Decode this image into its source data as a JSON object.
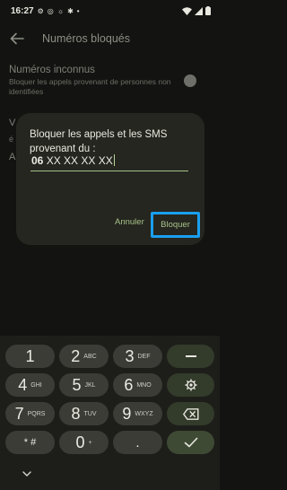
{
  "status_bar": {
    "time": "16:27"
  },
  "app_bar": {
    "title": "Numéros bloqués"
  },
  "settings": {
    "unknown_title": "Numéros inconnus",
    "unknown_summary": "Bloquer les appels provenant de personnes non identifiées",
    "obscured_1": "V",
    "obscured_2": "é",
    "obscured_3": "A"
  },
  "dialog": {
    "title": "Bloquer les appels et les SMS provenant du :",
    "input_value_bold": "06",
    "input_value_rest": " XX XX XX XX",
    "cancel_label": "Annuler",
    "confirm_label": "Bloquer"
  },
  "keyboard": {
    "keys": [
      {
        "main": "1",
        "sub": ""
      },
      {
        "main": "2",
        "sub": "ABC"
      },
      {
        "main": "3",
        "sub": "DEF"
      },
      {
        "main": "4",
        "sub": "GHI"
      },
      {
        "main": "5",
        "sub": "JKL"
      },
      {
        "main": "6",
        "sub": "MNO"
      },
      {
        "main": "7",
        "sub": "PQRS"
      },
      {
        "main": "8",
        "sub": "TUV"
      },
      {
        "main": "9",
        "sub": "WXYZ"
      },
      {
        "main": "* #",
        "sub": ""
      },
      {
        "main": "0",
        "sub": "+"
      },
      {
        "main": ".",
        "sub": ""
      }
    ]
  },
  "colors": {
    "accent": "#a6c28a",
    "focus_outline": "#1a9ff0",
    "dialog_bg": "#25261f"
  },
  "icons": [
    "settings-icon",
    "compass-icon",
    "brightness-icon",
    "bluetooth-icon",
    "dot-icon",
    "wifi-icon",
    "signal-icon",
    "battery-icon",
    "back-arrow-icon",
    "minus-icon",
    "settings-key-icon",
    "backspace-icon",
    "checkmark-icon",
    "chevron-down-icon"
  ]
}
